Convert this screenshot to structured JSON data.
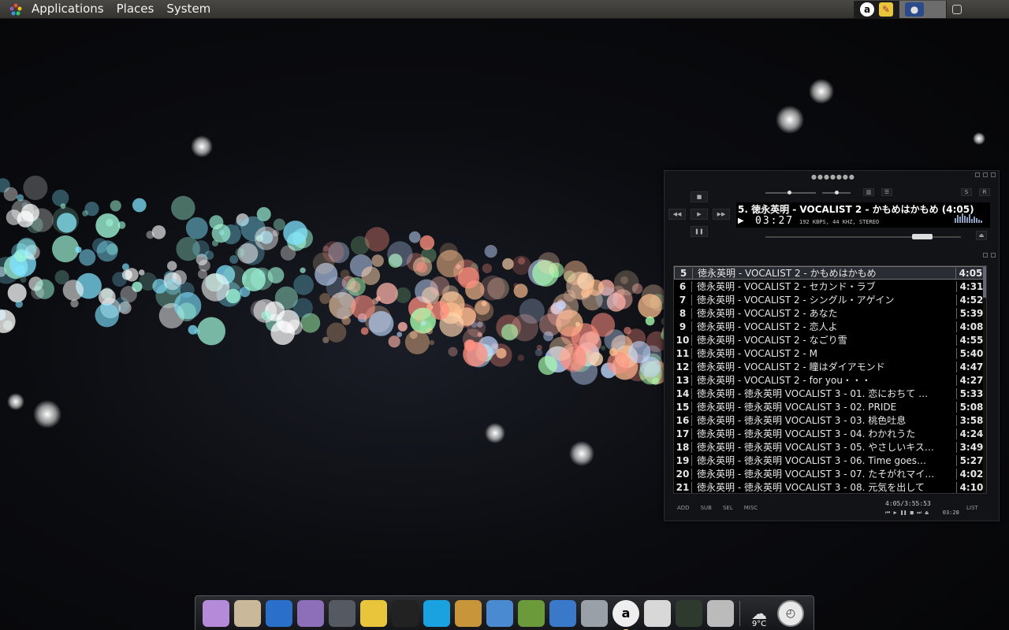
{
  "top_panel": {
    "menus": [
      "Applications",
      "Places",
      "System"
    ],
    "tray": {
      "audacious_icon": "audacious-icon",
      "notes_icon": "notes-icon",
      "workspace_icon": "workspace-switcher-icon",
      "show_desktop_icon": "show-desktop-icon"
    }
  },
  "player": {
    "now_playing": "5. 徳永英明 - VOCALIST 2 - かもめはかもめ (4:05)",
    "elapsed": "03:27",
    "stream_info": "192 KBPS, 44 KHZ, STEREO",
    "progress": 0.84,
    "playlist": [
      {
        "num": "5",
        "title": "徳永英明 - VOCALIST 2 - かもめはかもめ",
        "duration": "4:05",
        "selected": true
      },
      {
        "num": "6",
        "title": "徳永英明 - VOCALIST 2 - セカンド・ラブ",
        "duration": "4:31"
      },
      {
        "num": "7",
        "title": "徳永英明 - VOCALIST 2 - シングル・アゲイン",
        "duration": "4:52"
      },
      {
        "num": "8",
        "title": "徳永英明 - VOCALIST 2 - あなた",
        "duration": "5:39"
      },
      {
        "num": "9",
        "title": "徳永英明 - VOCALIST 2 - 恋人よ",
        "duration": "4:08"
      },
      {
        "num": "10",
        "title": "徳永英明 - VOCALIST 2 - なごり雪",
        "duration": "4:55"
      },
      {
        "num": "11",
        "title": "徳永英明 - VOCALIST 2 - M",
        "duration": "5:40"
      },
      {
        "num": "12",
        "title": "徳永英明 - VOCALIST 2 - 瞳はダイアモンド",
        "duration": "4:47"
      },
      {
        "num": "13",
        "title": "徳永英明 - VOCALIST 2 - for you・・・",
        "duration": "4:27"
      },
      {
        "num": "14",
        "title": "徳永英明 - 徳永英明  VOCALIST 3  - 01. 恋におちて  …",
        "duration": "5:33"
      },
      {
        "num": "15",
        "title": "徳永英明 - 徳永英明  VOCALIST 3 - 02.  PRIDE",
        "duration": "5:08"
      },
      {
        "num": "16",
        "title": "徳永英明 - 徳永英明  VOCALIST 3  - 03. 桃色吐息",
        "duration": "3:58"
      },
      {
        "num": "17",
        "title": "徳永英明 - 徳永英明  VOCALIST 3  - 04. わかれうた",
        "duration": "4:24"
      },
      {
        "num": "18",
        "title": "徳永英明 - 徳永英明  VOCALIST 3  - 05. やさしいキス…",
        "duration": "3:49"
      },
      {
        "num": "19",
        "title": "徳永英明 - 徳永英明  VOCALIST 3  - 06. Time  goes…",
        "duration": "5:27"
      },
      {
        "num": "20",
        "title": "徳永英明 - 徳永英明  VOCALIST 3  - 07. たそがれマイ…",
        "duration": "4:02"
      },
      {
        "num": "21",
        "title": "徳永英明 - 徳永英明  VOCALIST 3  - 08. 元気を出して",
        "duration": "4:10"
      }
    ],
    "bottom_buttons": [
      "ADD",
      "SUB",
      "SEL",
      "MISC"
    ],
    "totals": "4:05/3:55:53",
    "mini_time": "03:28",
    "list_button": "LIST"
  },
  "dock": {
    "items": [
      {
        "name": "settings-app-icon",
        "color": "#b58ad8"
      },
      {
        "name": "file-manager-icon",
        "color": "#c9b89a"
      },
      {
        "name": "browser-globe-icon",
        "color": "#2a6fc9"
      },
      {
        "name": "pidgin-chat-icon",
        "color": "#8c6fb8"
      },
      {
        "name": "monitor-icon",
        "color": "#555a62"
      },
      {
        "name": "text-editor-icon",
        "color": "#e8c53a"
      },
      {
        "name": "qq-penguin-icon",
        "color": "#222"
      },
      {
        "name": "skype-icon",
        "color": "#1aa1e0"
      },
      {
        "name": "gnu-icon",
        "color": "#c8953a"
      },
      {
        "name": "chromium-icon",
        "color": "#4a8ad0"
      },
      {
        "name": "book-icon",
        "color": "#6b9a3a"
      },
      {
        "name": "chart-app-icon",
        "color": "#3a78c9"
      },
      {
        "name": "webcam-icon",
        "color": "#9aa0a8"
      },
      {
        "name": "audacious-dock-icon",
        "color": "#eee",
        "label": "a",
        "active": true
      },
      {
        "name": "gedit-icon",
        "color": "#d8d8d8"
      },
      {
        "name": "system-monitor-icon",
        "color": "#2e3a2e"
      },
      {
        "name": "disk-icon",
        "color": "#bbb"
      }
    ],
    "weather": {
      "temp": "9°C"
    },
    "clock_icon": "clock-icon"
  }
}
